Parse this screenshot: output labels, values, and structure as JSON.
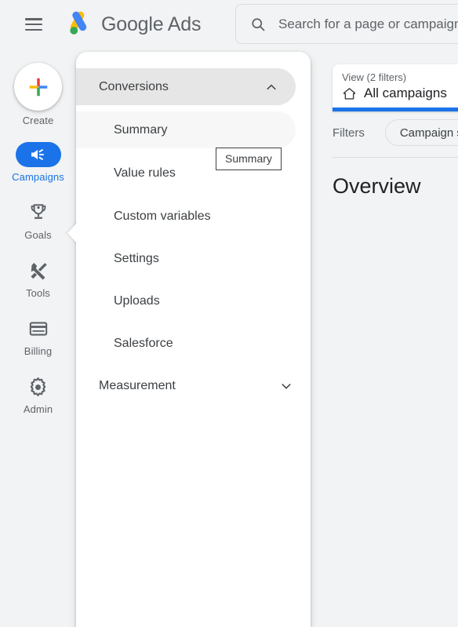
{
  "header": {
    "menu_button": "menu",
    "brand_google": "Google",
    "brand_ads": "Ads",
    "search": {
      "placeholder": "Search for a page or campaign",
      "value": "",
      "icon": "search-icon"
    }
  },
  "rail": {
    "items": [
      {
        "label": "Create",
        "icon": "plus-icon",
        "active": false
      },
      {
        "label": "Campaigns",
        "icon": "megaphone-icon",
        "active": true
      },
      {
        "label": "Goals",
        "icon": "trophy-icon",
        "active": false
      },
      {
        "label": "Tools",
        "icon": "tools-icon",
        "active": false
      },
      {
        "label": "Billing",
        "icon": "credit-card-icon",
        "active": false
      },
      {
        "label": "Admin",
        "icon": "gear-icon",
        "active": false
      }
    ]
  },
  "flyout": {
    "groups": [
      {
        "label": "Conversions",
        "expanded": true,
        "chevron": "chevron-up-icon",
        "items": [
          {
            "label": "Summary",
            "highlighted": true
          },
          {
            "label": "Value rules",
            "highlighted": false
          },
          {
            "label": "Custom variables",
            "highlighted": false
          },
          {
            "label": "Settings",
            "highlighted": false
          },
          {
            "label": "Uploads",
            "highlighted": false
          },
          {
            "label": "Salesforce",
            "highlighted": false
          }
        ]
      },
      {
        "label": "Measurement",
        "expanded": false,
        "chevron": "chevron-down-icon",
        "items": []
      }
    ],
    "tooltip": "Summary"
  },
  "content": {
    "view_card": {
      "subtitle": "View (2 filters)",
      "title": "All campaigns",
      "icon": "home-icon"
    },
    "filters_label": "Filters",
    "filter_chip": "Campaign st",
    "page_title": "Overview"
  },
  "colors": {
    "accent_blue": "#1a73e8",
    "page_bg": "#f1f3f4",
    "panel_bg": "#ffffff",
    "text_primary": "#3c4043",
    "text_secondary": "#5f6368",
    "group_shade": "#e6e6e6",
    "item_highlight": "#f7f7f7",
    "google_red": "#ea4335",
    "google_yellow": "#fbbc04",
    "google_green": "#34a853",
    "google_blue": "#4285f4"
  }
}
